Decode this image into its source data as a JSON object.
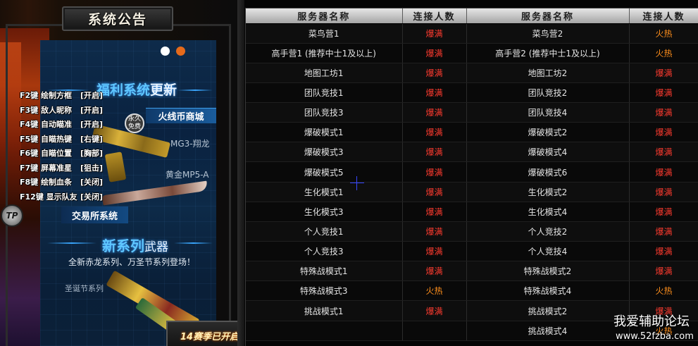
{
  "notice": {
    "title": "系统公告"
  },
  "banner": {
    "welfare_title_hl": "福利系统",
    "welfare_title_rest": "更新",
    "shop_label": "火线币商城",
    "permanent_badge": "永久\n免费",
    "weapon_1": "MG3-翔龙",
    "weapon_2": "黄金MP5-A",
    "trade_label": "交易所系统",
    "new_title_hl": "新系列",
    "new_title_rest": "武器",
    "new_subtitle": "全新赤龙系列、万圣节系列登场！",
    "xmas_label": "圣诞节系列"
  },
  "hotkeys": [
    {
      "key": "F2键 绘制方框",
      "state": "[开启]"
    },
    {
      "key": "F3键 敌人昵称",
      "state": "[开启]"
    },
    {
      "key": "F4键 自动瞄准",
      "state": "[开启]"
    },
    {
      "key": "F5键 自瞄热键",
      "state": "[右键]"
    },
    {
      "key": "F6键 自瞄位置",
      "state": "[胸部]"
    },
    {
      "key": "F7键 屏幕准星",
      "state": "[狙击]"
    },
    {
      "key": "F8键 绘制血条",
      "state": "[关闭]"
    },
    {
      "key": "F12键 显示队友",
      "state": "[关闭]"
    }
  ],
  "badge": {
    "tp": "TP"
  },
  "season": {
    "text": "14赛季已开启!"
  },
  "table": {
    "headers": [
      "服务器名称",
      "连接人数",
      "服务器名称",
      "连接人数"
    ],
    "rows": [
      {
        "a": "菜鸟营1",
        "as": "爆满",
        "b": "菜鸟营2",
        "bs": "火热"
      },
      {
        "a": "高手营1 (推荐中士1及以上)",
        "as": "爆满",
        "b": "高手营2 (推荐中士1及以上)",
        "bs": "火热"
      },
      {
        "a": "地图工坊1",
        "as": "爆满",
        "b": "地图工坊2",
        "bs": "爆满"
      },
      {
        "a": "团队竞技1",
        "as": "爆满",
        "b": "团队竞技2",
        "bs": "爆满"
      },
      {
        "a": "团队竞技3",
        "as": "爆满",
        "b": "团队竞技4",
        "bs": "爆满"
      },
      {
        "a": "爆破模式1",
        "as": "爆满",
        "b": "爆破模式2",
        "bs": "爆满"
      },
      {
        "a": "爆破模式3",
        "as": "爆满",
        "b": "爆破模式4",
        "bs": "爆满"
      },
      {
        "a": "爆破模式5",
        "as": "爆满",
        "b": "爆破模式6",
        "bs": "爆满"
      },
      {
        "a": "生化模式1",
        "as": "爆满",
        "b": "生化模式2",
        "bs": "爆满"
      },
      {
        "a": "生化模式3",
        "as": "爆满",
        "b": "生化模式4",
        "bs": "爆满"
      },
      {
        "a": "个人竞技1",
        "as": "爆满",
        "b": "个人竞技2",
        "bs": "爆满"
      },
      {
        "a": "个人竞技3",
        "as": "爆满",
        "b": "个人竞技4",
        "bs": "爆满"
      },
      {
        "a": "特殊战模式1",
        "as": "爆满",
        "b": "特殊战模式2",
        "bs": "爆满"
      },
      {
        "a": "特殊战模式3",
        "as": "火热",
        "b": "特殊战模式4",
        "bs": "火热"
      },
      {
        "a": "挑战模式1",
        "as": "爆满",
        "b": "挑战模式2",
        "bs": "爆满"
      },
      {
        "a": "",
        "as": "",
        "b": "挑战模式4",
        "bs": "火热"
      }
    ]
  },
  "watermark": {
    "line1": "我爱辅助论坛",
    "line2": "www.52fzba.com"
  },
  "colors": {
    "full": "#ff3b2f",
    "hot": "#ff8f1c",
    "accent_blue": "#3aa7ff"
  }
}
